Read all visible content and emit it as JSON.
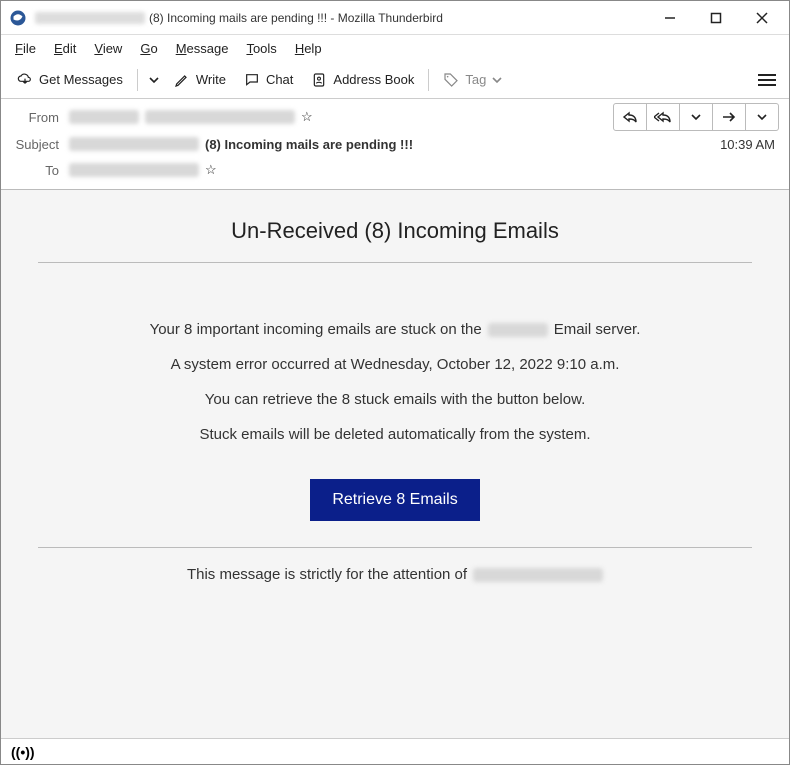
{
  "window": {
    "title_suffix": "(8) Incoming mails are pending !!! - Mozilla Thunderbird"
  },
  "menubar": {
    "file": "File",
    "edit": "Edit",
    "view": "View",
    "go": "Go",
    "message": "Message",
    "tools": "Tools",
    "help": "Help"
  },
  "toolbar": {
    "get_messages": "Get Messages",
    "write": "Write",
    "chat": "Chat",
    "address_book": "Address Book",
    "tag": "Tag"
  },
  "headers": {
    "from_label": "From",
    "subject_label": "Subject",
    "to_label": "To",
    "subject_text": "(8) Incoming mails are pending !!!",
    "time": "10:39 AM"
  },
  "body": {
    "title": "Un-Received (8) Incoming Emails",
    "line1a": "Your 8 important incoming emails are stuck on the",
    "line1b": "Email server.",
    "line2": "A system error occurred at  Wednesday, October 12, 2022 9:10 a.m.",
    "line3": "You can retrieve the 8 stuck emails with the button below.",
    "line4": "Stuck emails will be deleted automatically from the system.",
    "button": "Retrieve 8 Emails",
    "footer": "This message is strictly for the attention of"
  }
}
